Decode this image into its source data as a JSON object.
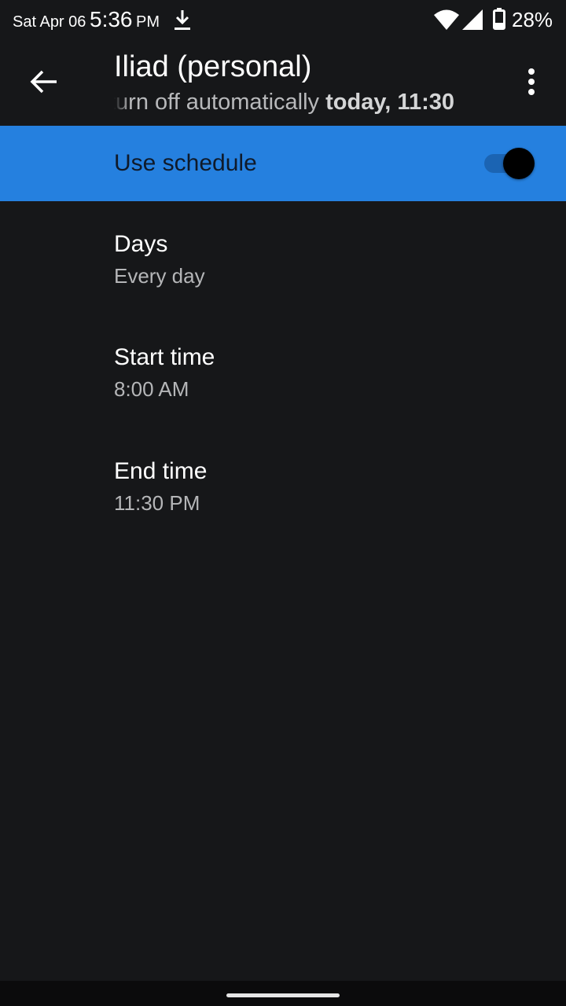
{
  "status_bar": {
    "date": "Sat Apr 06",
    "time": "5:36",
    "ampm": "PM",
    "battery": "28%",
    "icons": [
      "download-icon",
      "wifi-icon",
      "signal-icon",
      "battery-icon"
    ]
  },
  "app_bar": {
    "title": "Iliad (personal)",
    "subtitle_prefix": "turn off automatically ",
    "subtitle_bold": "today, 11:30",
    "icons": [
      "back-arrow-icon",
      "more-vert-icon"
    ]
  },
  "schedule": {
    "label": "Use schedule",
    "enabled": true,
    "accent_color": "#2580df"
  },
  "items": [
    {
      "title": "Days",
      "summary": "Every day"
    },
    {
      "title": "Start time",
      "summary": "8:00 AM"
    },
    {
      "title": "End time",
      "summary": "11:30 PM"
    }
  ]
}
